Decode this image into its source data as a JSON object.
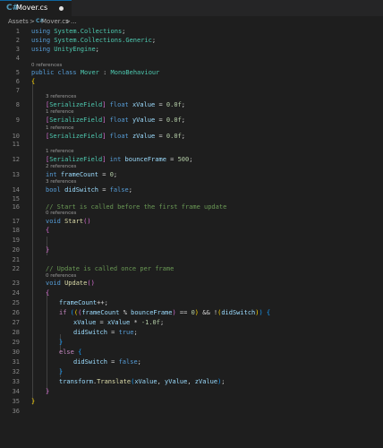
{
  "tab": {
    "title": "Mover.cs",
    "icon": "csharp-file-icon"
  },
  "breadcrumb": {
    "root": "Assets",
    "sep": ">",
    "file": "Mover.cs",
    "rest": "..."
  },
  "lens": {
    "l5": "0 references",
    "l8": "3 references",
    "l9": "1 reference",
    "l10": "1 reference",
    "l12": "1 reference",
    "l13": "2 references",
    "l14": "3 references",
    "l17": "0 references",
    "l23": "0 references"
  },
  "code": {
    "l1": {
      "kw": "using",
      "ns": "System.Collections",
      "end": ";"
    },
    "l2": {
      "kw": "using",
      "ns": "System.Collections.Generic",
      "end": ";"
    },
    "l3": {
      "kw": "using",
      "ns": "UnityEngine",
      "end": ";"
    },
    "l5": {
      "a": "public",
      "b": "class",
      "name": "Mover",
      "colon": ":",
      "base": "MonoBehaviour"
    },
    "l6": {
      "brace": "{"
    },
    "l8": {
      "b1": "[",
      "attr": "SerializeField",
      "b2": "]",
      "type": "float",
      "name": "xValue",
      "eq": "=",
      "val": "0.0f",
      "end": ";"
    },
    "l9": {
      "b1": "[",
      "attr": "SerializeField",
      "b2": "]",
      "type": "float",
      "name": "yValue",
      "eq": "=",
      "val": "0.0f",
      "end": ";"
    },
    "l10": {
      "b1": "[",
      "attr": "SerializeField",
      "b2": "]",
      "type": "float",
      "name": "zValue",
      "eq": "=",
      "val": "0.0f",
      "end": ";"
    },
    "l12": {
      "b1": "[",
      "attr": "SerializeField",
      "b2": "]",
      "type": "int",
      "name": "bounceFrame",
      "eq": "=",
      "val": "500",
      "end": ";"
    },
    "l13": {
      "type": "int",
      "name": "frameCount",
      "eq": "=",
      "val": "0",
      "end": ";"
    },
    "l14": {
      "type": "bool",
      "name": "didSwitch",
      "eq": "=",
      "val": "false",
      "end": ";"
    },
    "l16": {
      "comment": "// Start is called before the first frame update"
    },
    "l17": {
      "type": "void",
      "fn": "Start",
      "paren": "()"
    },
    "l18": {
      "brace": "{"
    },
    "l20": {
      "brace": "}"
    },
    "l22": {
      "comment": "// Update is called once per frame"
    },
    "l23": {
      "type": "void",
      "fn": "Update",
      "paren": "()"
    },
    "l24": {
      "brace": "{"
    },
    "l25": {
      "name": "frameCount",
      "op": "++;"
    },
    "l26": {
      "kw": "if",
      "p1": "(",
      "p2": "(",
      "p3": "(",
      "v1": "frameCount",
      "op1": "%",
      "v2": "bounceFrame",
      "p3c": ")",
      "op2": "==",
      "num": "0",
      "p2c": ")",
      "op3": "&&",
      "not": "!",
      "p4": "(",
      "v3": "didSwitch",
      "p4c": ")",
      "p1c": ")",
      "brace": "{"
    },
    "l27": {
      "v1": "xValue",
      "eq": "=",
      "v2": "xValue",
      "op": "*",
      "num": "-1.0f",
      "end": ";"
    },
    "l28": {
      "v1": "didSwitch",
      "eq": "=",
      "val": "true",
      "end": ";"
    },
    "l29": {
      "brace": "}"
    },
    "l30": {
      "kw": "else",
      "brace": "{"
    },
    "l31": {
      "v1": "didSwitch",
      "eq": "=",
      "val": "false",
      "end": ";"
    },
    "l32": {
      "brace": "}"
    },
    "l33": {
      "obj": "transform",
      "dot": ".",
      "fn": "Translate",
      "p": "(",
      "a1": "xValue",
      "c1": ",",
      "a2": "yValue",
      "c2": ",",
      "a3": "zValue",
      "pc": ")",
      "end": ";"
    },
    "l34": {
      "brace": "}"
    },
    "l35": {
      "brace": "}"
    }
  },
  "line_numbers": [
    "1",
    "2",
    "3",
    "4",
    "5",
    "6",
    "7",
    "8",
    "9",
    "10",
    "11",
    "12",
    "13",
    "14",
    "15",
    "16",
    "17",
    "18",
    "19",
    "20",
    "21",
    "22",
    "23",
    "24",
    "25",
    "26",
    "27",
    "28",
    "29",
    "30",
    "31",
    "32",
    "33",
    "34",
    "35",
    "36"
  ]
}
